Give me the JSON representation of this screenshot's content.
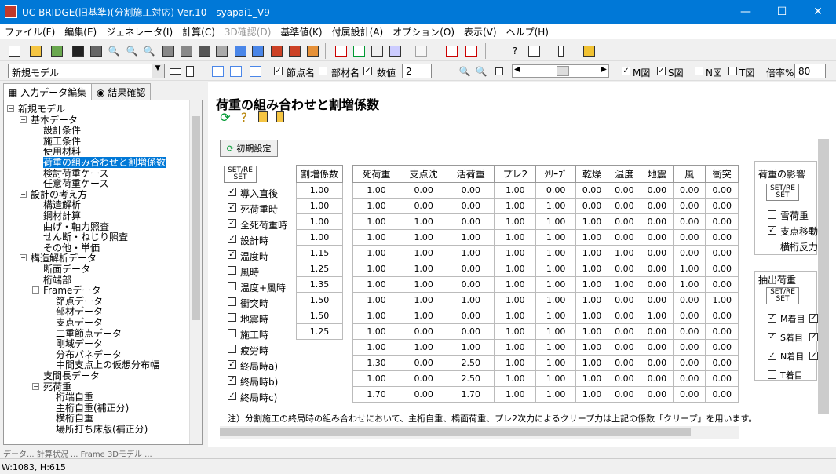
{
  "window": {
    "title": "UC-BRIDGE(旧基準)(分割施工対応) Ver.10 - syapai1_V9",
    "min_glyph": "—",
    "max_glyph": "☐",
    "close_glyph": "✕"
  },
  "menu": [
    "ファイル(F)",
    "編集(E)",
    "ジェネレータ(I)",
    "計算(C)",
    "3D確認(D)",
    "基準値(K)",
    "付属設計(A)",
    "オプション(O)",
    "表示(V)",
    "ヘルプ(H)"
  ],
  "toolbar": {
    "model": "新規モデル",
    "node_name": "節点名",
    "member_name": "部材名",
    "value": "数値",
    "digits": "2",
    "m_view": "M図",
    "s_view": "S図",
    "n_view": "N図",
    "t_view": "T図",
    "zoom_label": "倍率%",
    "zoom": "80",
    "check": "✓",
    "help_glyph": "?"
  },
  "left_tabs": [
    "入力データ編集",
    "結果確認"
  ],
  "tree": [
    {
      "label": "新規モデル",
      "depth": 0,
      "box": "−"
    },
    {
      "label": "基本データ",
      "depth": 1,
      "box": "−"
    },
    {
      "label": "設計条件",
      "depth": 2
    },
    {
      "label": "施工条件",
      "depth": 2
    },
    {
      "label": "使用材料",
      "depth": 2
    },
    {
      "label": "荷重の組み合わせと割増係数",
      "depth": 2,
      "selected": true
    },
    {
      "label": "検討荷重ケース",
      "depth": 2
    },
    {
      "label": "任意荷重ケース",
      "depth": 2
    },
    {
      "label": "設計の考え方",
      "depth": 1,
      "box": "−"
    },
    {
      "label": "構造解析",
      "depth": 2
    },
    {
      "label": "鋼材計算",
      "depth": 2
    },
    {
      "label": "曲げ・軸力照査",
      "depth": 2
    },
    {
      "label": "せん断・ねじり照査",
      "depth": 2
    },
    {
      "label": "その他・単価",
      "depth": 2
    },
    {
      "label": "構造解析データ",
      "depth": 1,
      "box": "−"
    },
    {
      "label": "断面データ",
      "depth": 2
    },
    {
      "label": "桁端部",
      "depth": 2
    },
    {
      "label": "Frameデータ",
      "depth": 2,
      "box": "−"
    },
    {
      "label": "節点データ",
      "depth": 3
    },
    {
      "label": "部材データ",
      "depth": 3
    },
    {
      "label": "支点データ",
      "depth": 3
    },
    {
      "label": "二重節点データ",
      "depth": 3
    },
    {
      "label": "剛域データ",
      "depth": 3
    },
    {
      "label": "分布バネデータ",
      "depth": 3
    },
    {
      "label": "中間支点上の仮想分布幅",
      "depth": 3
    },
    {
      "label": "支間長データ",
      "depth": 2
    },
    {
      "label": "死荷重",
      "depth": 2,
      "box": "−"
    },
    {
      "label": "桁端自重",
      "depth": 3
    },
    {
      "label": "主桁自重(補正分)",
      "depth": 3
    },
    {
      "label": "横桁自重",
      "depth": 3
    },
    {
      "label": "場所打ち床版(補正分)",
      "depth": 3
    }
  ],
  "main": {
    "title": "荷重の組み合わせと割増係数",
    "refresh_glyph": "⟳",
    "help_glyph": "?",
    "check_glyph": "✓",
    "reset": "初期設定",
    "set_reset": "SET/RE SET",
    "factor_header": "割増係数",
    "columns": [
      "死荷重",
      "支点沈",
      "活荷重",
      "プレ2",
      "ｸﾘｰﾌﾟ",
      "乾燥",
      "温度",
      "地震",
      "風",
      "衝突"
    ],
    "rows": [
      {
        "name": "導入直後",
        "checked": true,
        "factor": "1.00",
        "values": [
          "1.00",
          "0.00",
          "0.00",
          "1.00",
          "0.00",
          "0.00",
          "0.00",
          "0.00",
          "0.00",
          "0.00"
        ]
      },
      {
        "name": "死荷重時",
        "checked": true,
        "factor": "1.00",
        "values": [
          "1.00",
          "0.00",
          "0.00",
          "1.00",
          "1.00",
          "0.00",
          "0.00",
          "0.00",
          "0.00",
          "0.00"
        ]
      },
      {
        "name": "全死荷重時",
        "checked": true,
        "factor": "1.00",
        "values": [
          "1.00",
          "1.00",
          "0.00",
          "1.00",
          "1.00",
          "1.00",
          "0.00",
          "0.00",
          "0.00",
          "0.00"
        ]
      },
      {
        "name": "設計時",
        "checked": true,
        "factor": "1.00",
        "values": [
          "1.00",
          "1.00",
          "1.00",
          "1.00",
          "1.00",
          "1.00",
          "0.00",
          "0.00",
          "0.00",
          "0.00"
        ]
      },
      {
        "name": "温度時",
        "checked": true,
        "factor": "1.15",
        "values": [
          "1.00",
          "1.00",
          "1.00",
          "1.00",
          "1.00",
          "1.00",
          "1.00",
          "0.00",
          "0.00",
          "0.00"
        ]
      },
      {
        "name": "風時",
        "checked": false,
        "factor": "1.25",
        "values": [
          "1.00",
          "1.00",
          "0.00",
          "1.00",
          "1.00",
          "1.00",
          "0.00",
          "0.00",
          "1.00",
          "0.00"
        ]
      },
      {
        "name": "温度+風時",
        "checked": false,
        "factor": "1.35",
        "values": [
          "1.00",
          "1.00",
          "0.00",
          "1.00",
          "1.00",
          "1.00",
          "1.00",
          "0.00",
          "1.00",
          "0.00"
        ]
      },
      {
        "name": "衝突時",
        "checked": false,
        "factor": "1.50",
        "values": [
          "1.00",
          "1.00",
          "1.00",
          "1.00",
          "1.00",
          "1.00",
          "0.00",
          "0.00",
          "0.00",
          "1.00"
        ]
      },
      {
        "name": "地震時",
        "checked": false,
        "factor": "1.50",
        "values": [
          "1.00",
          "1.00",
          "0.00",
          "1.00",
          "1.00",
          "1.00",
          "0.00",
          "1.00",
          "0.00",
          "0.00"
        ]
      },
      {
        "name": "施工時",
        "checked": false,
        "factor": "1.25",
        "values": [
          "1.00",
          "0.00",
          "0.00",
          "1.00",
          "1.00",
          "1.00",
          "0.00",
          "0.00",
          "0.00",
          "0.00"
        ]
      },
      {
        "name": "疲労時",
        "checked": false,
        "factor": "",
        "values": [
          "1.00",
          "1.00",
          "1.00",
          "1.00",
          "1.00",
          "1.00",
          "0.00",
          "0.00",
          "0.00",
          "0.00"
        ]
      },
      {
        "name": "終局時a)",
        "checked": true,
        "factor": "",
        "values": [
          "1.30",
          "0.00",
          "2.50",
          "1.00",
          "1.00",
          "1.00",
          "0.00",
          "0.00",
          "0.00",
          "0.00"
        ]
      },
      {
        "name": "終局時b)",
        "checked": true,
        "factor": "",
        "values": [
          "1.00",
          "0.00",
          "2.50",
          "1.00",
          "1.00",
          "1.00",
          "0.00",
          "0.00",
          "0.00",
          "0.00"
        ]
      },
      {
        "name": "終局時c)",
        "checked": true,
        "factor": "",
        "values": [
          "1.70",
          "0.00",
          "1.70",
          "1.00",
          "1.00",
          "1.00",
          "0.00",
          "0.00",
          "0.00",
          "0.00"
        ]
      }
    ],
    "influence": {
      "title": "荷重の影響",
      "items": [
        "雪荷重",
        "支点移動",
        "横桁反力"
      ]
    },
    "extract": {
      "title": "抽出荷重",
      "items": [
        "M着目",
        "S着目",
        "N着目",
        "T着目"
      ]
    },
    "note": "注）分割施工の終局時の組み合わせにおいて、主桁自重、橋面荷重、プレ2次力によるクリープ力は上記の係数「クリープ」を用います。"
  },
  "bottom_tabs": "データ... 計算状況 ... Frame 3Dモデル ...",
  "status": {
    "size": "W:1083, H:615"
  }
}
